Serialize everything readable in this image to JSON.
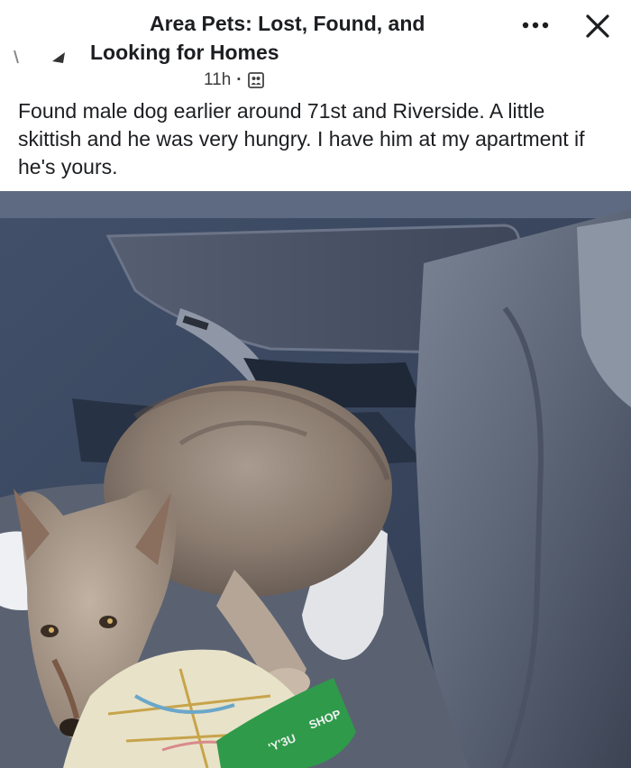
{
  "post": {
    "group_name_line1": "Area Pets: Lost, Found, and",
    "group_name_line2": "Looking for Homes",
    "time": "11h",
    "separator": "·",
    "audience_icon": "group-members-icon",
    "text": "Found male dog earlier around 71st and Riverside. A little skittish and he was very hungry. I have him at my apartment if he's yours."
  },
  "controls": {
    "more_icon": "more-options-icon",
    "close_icon": "close-icon"
  },
  "photo": {
    "subject": "coyote",
    "bag_text": "SHOP",
    "bag_text_partial": "'Y'3U"
  }
}
